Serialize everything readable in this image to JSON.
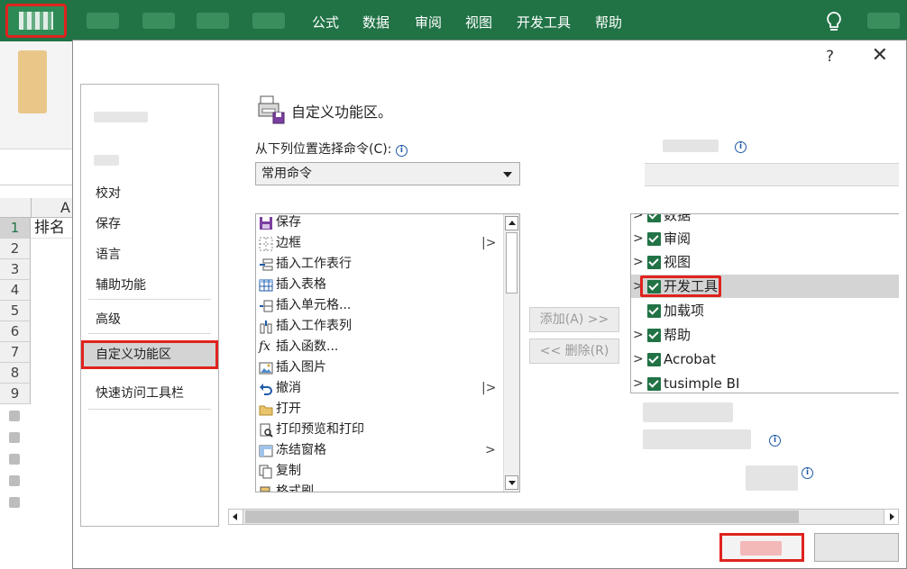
{
  "ribbon": {
    "tabs": [
      "公式",
      "数据",
      "审阅",
      "视图",
      "开发工具",
      "帮助"
    ]
  },
  "sheet": {
    "column_header": "A",
    "rows": [
      "1",
      "2",
      "3",
      "4",
      "5",
      "6",
      "7",
      "8",
      "9"
    ],
    "cell_a1": "排名"
  },
  "dialog": {
    "help": "?",
    "close": "✕",
    "nav": {
      "items": [
        "校对",
        "保存",
        "语言",
        "辅助功能",
        "高级",
        "自定义功能区",
        "快速访问工具栏"
      ],
      "active": "自定义功能区"
    },
    "section_title": "自定义功能区。",
    "choose_label": "从下列位置选择命令(C):",
    "info_icon": "i",
    "command_source": "常用命令",
    "commands": [
      {
        "label": "保存",
        "icon": "save-icon",
        "submenu": false
      },
      {
        "label": "边框",
        "icon": "border-icon",
        "submenu": true
      },
      {
        "label": "插入工作表行",
        "icon": "insert-row-icon",
        "submenu": false
      },
      {
        "label": "插入表格",
        "icon": "table-icon",
        "submenu": false
      },
      {
        "label": "插入单元格...",
        "icon": "insert-cell-icon",
        "submenu": false
      },
      {
        "label": "插入工作表列",
        "icon": "insert-column-icon",
        "submenu": false
      },
      {
        "label": "插入函数...",
        "icon": "function-icon",
        "submenu": false
      },
      {
        "label": "插入图片",
        "icon": "picture-icon",
        "submenu": false
      },
      {
        "label": "撤消",
        "icon": "undo-icon",
        "submenu": true
      },
      {
        "label": "打开",
        "icon": "folder-icon",
        "submenu": false
      },
      {
        "label": "打印预览和打印",
        "icon": "print-preview-icon",
        "submenu": false
      },
      {
        "label": "冻结窗格",
        "icon": "freeze-panes-icon",
        "submenu": true
      },
      {
        "label": "复制",
        "icon": "copy-icon",
        "submenu": false
      },
      {
        "label": "格式刷",
        "icon": "format-painter-icon",
        "submenu": false
      }
    ],
    "add_button": "添加(A) >>",
    "remove_button": "<< 删除(R)",
    "tabs_tree": [
      {
        "label": "数据",
        "expandable": true,
        "checked": true
      },
      {
        "label": "审阅",
        "expandable": true,
        "checked": true
      },
      {
        "label": "视图",
        "expandable": true,
        "checked": true
      },
      {
        "label": "开发工具",
        "expandable": true,
        "checked": true,
        "selected": true,
        "highlighted": true
      },
      {
        "label": "加载项",
        "expandable": false,
        "checked": true
      },
      {
        "label": "帮助",
        "expandable": true,
        "checked": true
      },
      {
        "label": "Acrobat",
        "expandable": true,
        "checked": true
      },
      {
        "label": "tusimple BI",
        "expandable": true,
        "checked": true
      }
    ],
    "colors": {
      "excel_green": "#217346",
      "highlight_red": "#e0231e",
      "selection_gray": "#d4d4d4"
    }
  }
}
